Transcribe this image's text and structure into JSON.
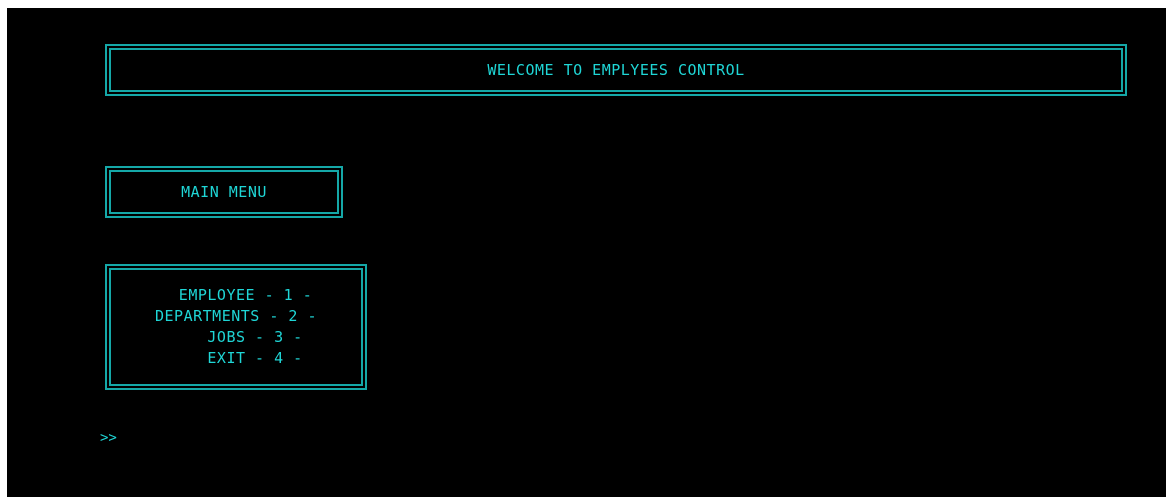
{
  "header": {
    "title": "WELCOME TO EMPLYEES CONTROL"
  },
  "menu": {
    "title": "MAIN MENU",
    "options": [
      "  EMPLOYEE - 1 -",
      "DEPARTMENTS - 2 -",
      "    JOBS - 3 -",
      "    EXIT - 4 -"
    ]
  },
  "prompt": {
    "symbol": ">>"
  },
  "colors": {
    "background": "#000000",
    "border": "#15a8a8",
    "text": "#1fd6d6"
  }
}
